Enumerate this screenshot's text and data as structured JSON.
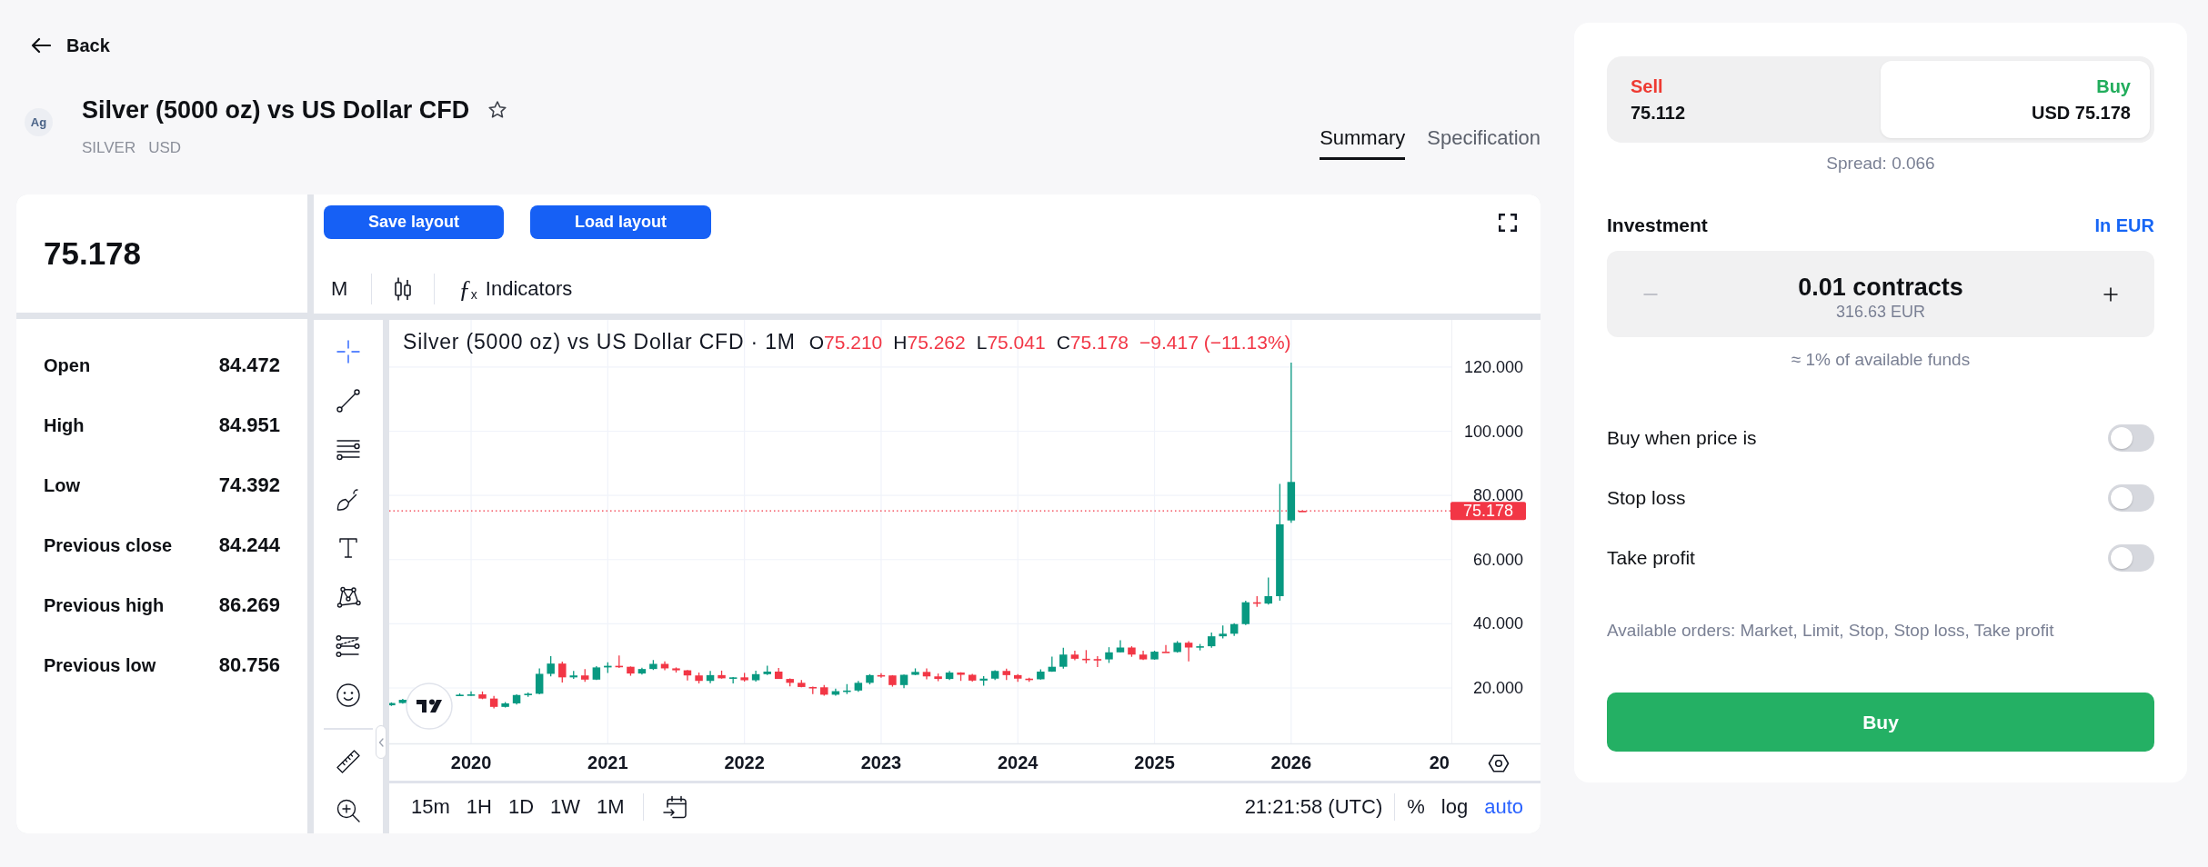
{
  "back": {
    "label": "Back"
  },
  "instrument": {
    "logo": "Ag",
    "title": "Silver (5000 oz) vs US Dollar CFD",
    "favorite": false,
    "symbols": [
      "SILVER",
      "USD"
    ]
  },
  "tabs": [
    {
      "label": "Summary",
      "selected": true
    },
    {
      "label": "Specification",
      "selected": false
    }
  ],
  "quote": {
    "price": "75.178",
    "stats": [
      {
        "label": "Open",
        "value": "84.472"
      },
      {
        "label": "High",
        "value": "84.951"
      },
      {
        "label": "Low",
        "value": "74.392"
      },
      {
        "label": "Previous close",
        "value": "84.244"
      },
      {
        "label": "Previous high",
        "value": "86.269"
      },
      {
        "label": "Previous low",
        "value": "80.756"
      }
    ]
  },
  "chart_toolbar": {
    "layout_buttons": [
      "Save layout",
      "Load layout"
    ],
    "interval": "M",
    "indicators_icon": "ƒ$_{x}$",
    "indicators": "Indicators"
  },
  "drawing_tools": [
    {
      "kind": "crosshair",
      "selected": true
    },
    {
      "kind": "trend-line",
      "selected": false
    },
    {
      "kind": "parallel-lines",
      "selected": false
    },
    {
      "kind": "brush",
      "selected": false
    },
    {
      "kind": "text",
      "selected": false
    },
    {
      "kind": "pattern",
      "selected": false
    },
    {
      "kind": "projection",
      "selected": false
    },
    {
      "kind": "emoji",
      "selected": false
    }
  ],
  "measure_tools": [
    {
      "kind": "ruler",
      "selected": false
    },
    {
      "kind": "zoom",
      "selected": false
    }
  ],
  "chart": {
    "legend": {
      "title": "Silver (5000 oz) vs US Dollar CFD · 1M",
      "ohlc": [
        {
          "label": "O",
          "value": "75.210"
        },
        {
          "label": "H",
          "value": "75.262"
        },
        {
          "label": "L",
          "value": "75.041"
        },
        {
          "label": "C",
          "value": "75.178"
        }
      ],
      "change": "−9.417 (−11.13%)"
    },
    "time_axis_cut_label": "20",
    "chart_data": {
      "type": "candlestick",
      "x": [
        2019.417,
        2019.5,
        2019.917,
        2020,
        2020.083,
        2020.167,
        2020.25,
        2020.333,
        2020.417,
        2020.5,
        2020.583,
        2020.667,
        2020.75,
        2020.833,
        2020.917,
        2021,
        2021.083,
        2021.167,
        2021.25,
        2021.333,
        2021.417,
        2021.5,
        2021.583,
        2021.667,
        2021.75,
        2021.833,
        2021.917,
        2022,
        2022.083,
        2022.167,
        2022.25,
        2022.333,
        2022.417,
        2022.5,
        2022.583,
        2022.667,
        2022.75,
        2022.833,
        2022.917,
        2023,
        2023.083,
        2023.167,
        2023.25,
        2023.333,
        2023.417,
        2023.5,
        2023.583,
        2023.667,
        2023.75,
        2023.833,
        2023.917,
        2024,
        2024.083,
        2024.167,
        2024.25,
        2024.333,
        2024.417,
        2024.5,
        2024.583,
        2024.667,
        2024.75,
        2024.833,
        2024.917,
        2025,
        2025.083,
        2025.167,
        2025.25,
        2025.333,
        2025.417,
        2025.5,
        2025.583,
        2025.667,
        2025.75,
        2025.833,
        2025.917,
        2026,
        2026.083
      ],
      "ohlc": [
        [
          14.6,
          15.5,
          14.4,
          15.3
        ],
        [
          15.3,
          16.6,
          15.1,
          16.3
        ],
        [
          17.8,
          18.3,
          17.5,
          17.9
        ],
        [
          17.9,
          18.9,
          17.5,
          18.0
        ],
        [
          18.0,
          18.9,
          16.5,
          16.7
        ],
        [
          16.7,
          17.5,
          13.6,
          14.1
        ],
        [
          14.1,
          15.6,
          13.9,
          15.2
        ],
        [
          15.2,
          18.0,
          14.8,
          17.8
        ],
        [
          17.8,
          18.6,
          17.2,
          18.2
        ],
        [
          18.2,
          26.1,
          18.0,
          24.4
        ],
        [
          24.4,
          29.9,
          23.6,
          27.6
        ],
        [
          27.6,
          28.2,
          21.7,
          23.3
        ],
        [
          23.3,
          25.3,
          22.8,
          23.9
        ],
        [
          23.9,
          25.9,
          21.9,
          22.6
        ],
        [
          22.6,
          26.8,
          22.5,
          26.4
        ],
        [
          26.4,
          28.0,
          24.7,
          26.9
        ],
        [
          26.9,
          30.1,
          26.2,
          26.6
        ],
        [
          26.6,
          26.7,
          23.8,
          24.5
        ],
        [
          24.5,
          26.3,
          24.2,
          25.9
        ],
        [
          25.9,
          28.7,
          25.6,
          27.5
        ],
        [
          27.5,
          28.3,
          25.5,
          26.1
        ],
        [
          26.1,
          26.4,
          24.8,
          25.5
        ],
        [
          25.5,
          25.6,
          22.3,
          23.9
        ],
        [
          23.9,
          24.8,
          21.4,
          22.2
        ],
        [
          22.2,
          25.3,
          21.5,
          24.0
        ],
        [
          24.0,
          25.4,
          22.9,
          23.0
        ],
        [
          23.0,
          23.4,
          21.4,
          23.3
        ],
        [
          23.3,
          24.7,
          22.0,
          22.4
        ],
        [
          22.4,
          25.4,
          22.0,
          24.3
        ],
        [
          24.3,
          26.9,
          24.0,
          25.1
        ],
        [
          25.1,
          26.2,
          22.8,
          22.8
        ],
        [
          22.8,
          23.0,
          20.5,
          21.6
        ],
        [
          21.6,
          22.5,
          20.2,
          20.3
        ],
        [
          20.3,
          20.4,
          18.1,
          20.2
        ],
        [
          20.2,
          20.9,
          17.6,
          17.9
        ],
        [
          17.9,
          19.8,
          17.6,
          19.0
        ],
        [
          19.0,
          21.2,
          18.1,
          19.2
        ],
        [
          19.2,
          22.2,
          18.8,
          21.6
        ],
        [
          21.6,
          24.3,
          21.1,
          24.0
        ],
        [
          24.0,
          24.6,
          23.2,
          23.9
        ],
        [
          23.9,
          24.0,
          20.4,
          20.9
        ],
        [
          20.9,
          24.2,
          19.9,
          24.1
        ],
        [
          24.1,
          26.1,
          24.0,
          25.0
        ],
        [
          25.0,
          26.1,
          22.7,
          23.6
        ],
        [
          23.6,
          24.5,
          22.1,
          22.8
        ],
        [
          22.8,
          25.3,
          22.5,
          24.8
        ],
        [
          24.8,
          24.9,
          22.2,
          24.1
        ],
        [
          24.1,
          24.4,
          22.0,
          22.3
        ],
        [
          22.3,
          23.7,
          20.7,
          22.9
        ],
        [
          22.9,
          25.5,
          22.5,
          25.3
        ],
        [
          25.3,
          26.0,
          22.5,
          24.0
        ],
        [
          24.0,
          24.3,
          21.9,
          22.9
        ],
        [
          22.9,
          23.2,
          21.9,
          22.7
        ],
        [
          22.7,
          25.8,
          22.6,
          25.1
        ],
        [
          25.1,
          29.8,
          25.0,
          26.6
        ],
        [
          26.6,
          32.5,
          26.0,
          30.4
        ],
        [
          30.4,
          31.6,
          28.6,
          29.1
        ],
        [
          29.1,
          31.8,
          27.7,
          29.0
        ],
        [
          29.0,
          29.9,
          26.5,
          28.9
        ],
        [
          28.9,
          32.7,
          27.8,
          31.1
        ],
        [
          31.1,
          34.9,
          31.1,
          32.6
        ],
        [
          32.6,
          33.0,
          29.7,
          30.4
        ],
        [
          30.4,
          31.6,
          28.7,
          28.9
        ],
        [
          28.9,
          31.6,
          28.8,
          31.3
        ],
        [
          31.3,
          33.4,
          31.1,
          31.2
        ],
        [
          31.2,
          34.6,
          31.0,
          34.1
        ],
        [
          34.1,
          34.6,
          28.3,
          32.6
        ],
        [
          32.6,
          33.7,
          31.7,
          33.0
        ],
        [
          33.0,
          37.3,
          32.5,
          36.1
        ],
        [
          36.1,
          39.5,
          35.4,
          36.9
        ],
        [
          36.9,
          40.2,
          36.2,
          39.9
        ],
        [
          39.9,
          47.2,
          39.6,
          46.7
        ],
        [
          46.7,
          48.6,
          45.3,
          46.3
        ],
        [
          46.3,
          54.4,
          46.0,
          48.6
        ],
        [
          48.6,
          83.6,
          47.2,
          71.0
        ],
        [
          72.2,
          121.4,
          71.5,
          84.2
        ],
        [
          75.21,
          75.26,
          75.04,
          75.18
        ]
      ],
      "xlim": [
        2019.401,
        2027.824
      ],
      "ylim": [
        2.72,
        134.7
      ],
      "grid": true,
      "xticks": [
        2020,
        2021,
        2022,
        2023,
        2024,
        2025,
        2026
      ],
      "yticks": [
        {
          "value": 20,
          "label": "20.000"
        },
        {
          "value": 40,
          "label": "40.000"
        },
        {
          "value": 60,
          "label": "60.000"
        },
        {
          "value": 80,
          "label": "80.000"
        },
        {
          "value": 100,
          "label": "100.000"
        },
        {
          "value": 120,
          "label": "120.000"
        }
      ],
      "ref_lines": [
        {
          "axis": "y",
          "value": 75.178,
          "label": "75.178",
          "color": "#f23645"
        }
      ]
    }
  },
  "chart_bottom_bar": {
    "intervals": [
      "15m",
      "1H",
      "1D",
      "1W",
      "1M"
    ],
    "time": "21:21:58 (UTC)",
    "scales": [
      {
        "label": "%",
        "selected": false
      },
      {
        "label": "log",
        "selected": false
      },
      {
        "label": "auto",
        "selected": true
      }
    ]
  },
  "order_panel": {
    "sides": [
      {
        "label": "Sell",
        "price": "75.112",
        "color": "#ee3a32",
        "selected": false
      },
      {
        "label": "Buy",
        "price": "USD 75.178",
        "color": "#22ad5c",
        "selected": true
      }
    ],
    "spread": "Spread: 0.066",
    "investment": {
      "label": "Investment",
      "unit_link": "In EUR"
    },
    "amount": {
      "value": "0.01 contracts",
      "converted": "316.63 EUR",
      "decrease_disabled": true,
      "increase_disabled": false
    },
    "funds_note": "≈ 1% of available funds",
    "toggles": [
      {
        "label": "Buy when price is",
        "on": false
      },
      {
        "label": "Stop loss",
        "on": false
      },
      {
        "label": "Take profit",
        "on": false
      }
    ],
    "available_orders": "Available orders: Market, Limit, Stop, Stop loss, Take profit",
    "submit": "Buy"
  }
}
